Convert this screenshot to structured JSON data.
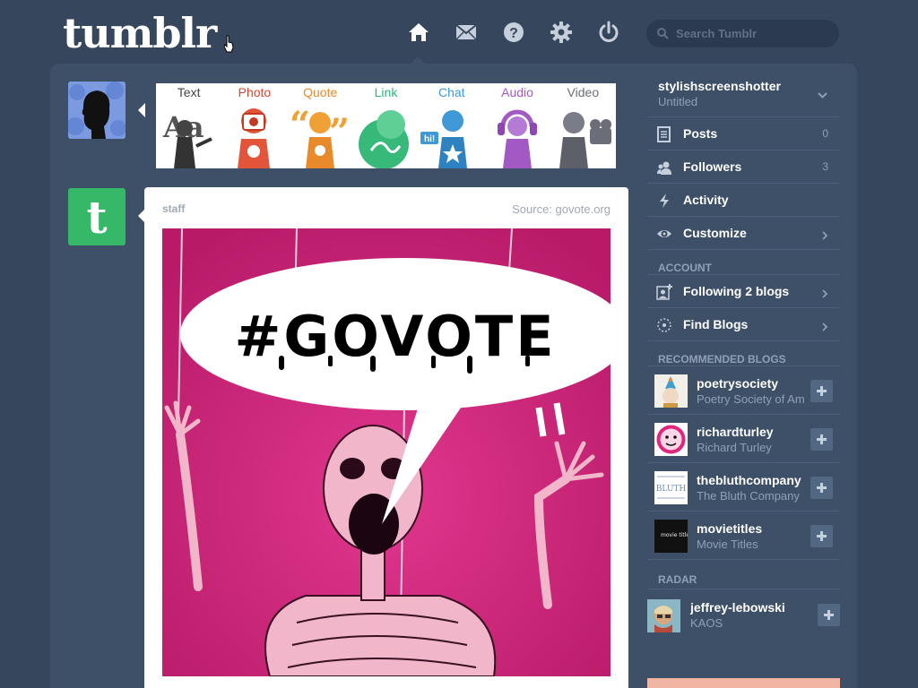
{
  "header": {
    "logo": "tumblr",
    "search_placeholder": "Search Tumblr",
    "nav": [
      "home-icon",
      "mail-icon",
      "help-icon",
      "gear-icon",
      "power-icon"
    ]
  },
  "post_types": [
    {
      "label": "Text",
      "color": "#444444"
    },
    {
      "label": "Photo",
      "color": "#d9442e"
    },
    {
      "label": "Quote",
      "color": "#e8892b"
    },
    {
      "label": "Link",
      "color": "#2fb87a"
    },
    {
      "label": "Chat",
      "color": "#3f99d6"
    },
    {
      "label": "Audio",
      "color": "#a259c4"
    },
    {
      "label": "Video",
      "color": "#6b6e78"
    }
  ],
  "post": {
    "author": "staff",
    "source": "Source: govote.org",
    "image_text": "#GOVOTE",
    "staff_avatar_letter": "t"
  },
  "sidebar": {
    "blog_name": "stylishscreenshotter",
    "blog_title": "Untitled",
    "stats": [
      {
        "label": "Posts",
        "count": "0",
        "icon": "posts-icon"
      },
      {
        "label": "Followers",
        "count": "3",
        "icon": "followers-icon"
      },
      {
        "label": "Activity",
        "count": "",
        "icon": "activity-icon"
      },
      {
        "label": "Customize",
        "count": "",
        "icon": "eye-icon"
      }
    ],
    "account_title": "ACCOUNT",
    "account": [
      {
        "label": "Following 2 blogs",
        "icon": "following-icon"
      },
      {
        "label": "Find Blogs",
        "icon": "find-blogs-icon"
      }
    ],
    "recommended_title": "RECOMMENDED BLOGS",
    "recommended": [
      {
        "name": "poetrysociety",
        "desc": "Poetry Society of Am"
      },
      {
        "name": "richardturley",
        "desc": "Richard Turley"
      },
      {
        "name": "thebluthcompany",
        "desc": "The Bluth Company"
      },
      {
        "name": "movietitles",
        "desc": "Movie Titles"
      }
    ],
    "radar_title": "RADAR",
    "radar": {
      "name": "jeffrey-lebowski",
      "desc": "KAOS"
    }
  },
  "thumb_text": {
    "bluth": "BLUTH",
    "movie": "movie titles"
  },
  "colors": {
    "background": "#36465d",
    "panel": "#3d5067",
    "staff_green": "#35b868",
    "govote_pink": "#d6237c"
  }
}
